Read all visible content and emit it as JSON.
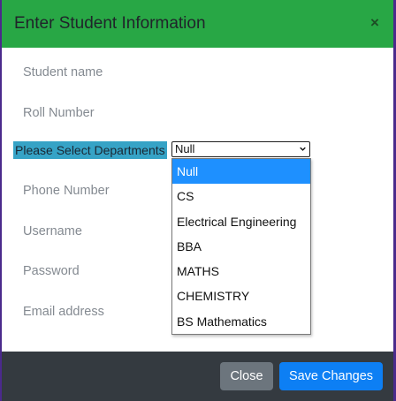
{
  "modal": {
    "title": "Enter Student Information",
    "close_symbol": "×"
  },
  "fields": {
    "student_name": "Student name",
    "roll_number": "Roll Number",
    "phone_number": "Phone Number",
    "username": "Username",
    "password": "Password",
    "email": "Email address"
  },
  "department": {
    "label": "Please Select Departments",
    "selected": "Null",
    "options": [
      "Null",
      "CS",
      "Electrical Engineering",
      "BBA",
      "MATHS",
      "CHEMISTRY",
      "BS Mathematics"
    ]
  },
  "footer": {
    "close_label": "Close",
    "save_label": "Save Changes"
  },
  "colors": {
    "header": "#28a745",
    "footer": "#343a40",
    "highlight": "#36a3c6",
    "selected_option": "#1e90ff",
    "save_button": "#0d7ff4",
    "close_button": "#6c757d"
  }
}
